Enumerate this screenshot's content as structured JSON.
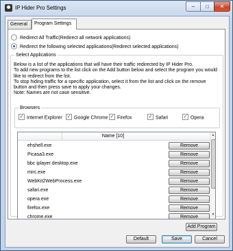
{
  "window": {
    "title": "IP Hider Pro Settings",
    "minimize": "–",
    "maximize": "□",
    "close": "✕"
  },
  "tabs": [
    {
      "label": "General"
    },
    {
      "label": "Program Settings"
    }
  ],
  "mode": {
    "all_label": "Redirect All Traffic(Redirect all network applications)",
    "selected_label": "Redirect the following selected applications(Redirect selected applications)",
    "selected_option": "selected"
  },
  "select_apps": {
    "group_title": "Select Applications",
    "info": [
      "Below is a list of the applications that will have their traffic redirected by IP Hider Pro.",
      "To add new programs to the list click on the Add button below and select the program you would like to redirect from the list.",
      "To stop hiding traffic for a specific application, select it from the list and click on the remove button and then press save to apply your changes.",
      "Note: Names are not case sensitive."
    ]
  },
  "browsers": {
    "group_title": "Browsers",
    "items": [
      {
        "label": "Internet Explorer",
        "checked": true
      },
      {
        "label": "Google Chrome",
        "checked": true
      },
      {
        "label": "Firefox",
        "checked": true
      },
      {
        "label": "Safari",
        "checked": true
      },
      {
        "label": "Opera",
        "checked": true
      }
    ],
    "check_glyph": "✓"
  },
  "app_list": {
    "header": "Name [10]",
    "remove_label": "Remove",
    "items": [
      "ehshell.exe",
      "Picasa3.exe",
      "bbc iplayer desktop.exe",
      "mirc.exe",
      "WebKit2WebProcess.exe",
      "safari.exe",
      "opera.exe",
      "firefox.exe",
      "chrome.exe"
    ],
    "scroll_up": "▲",
    "scroll_down": "▼"
  },
  "buttons": {
    "add_program": "Add Program",
    "default": "Default",
    "save": "Save",
    "cancel": "Cancel"
  }
}
